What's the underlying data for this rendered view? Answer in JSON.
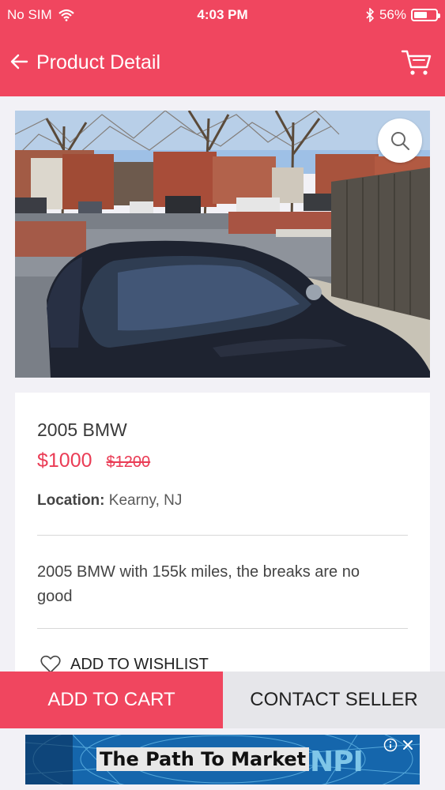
{
  "status_bar": {
    "carrier": "No SIM",
    "time": "4:03 PM",
    "battery": "56%",
    "battery_level": 0.56
  },
  "app_bar": {
    "title": "Product Detail"
  },
  "product": {
    "name": "2005 BMW",
    "price": "$1000",
    "old_price": "$1200",
    "location_label": "Location:",
    "location": "Kearny, NJ",
    "description": "2005 BMW with 155k miles, the breaks are no good",
    "wishlist_label": "ADD TO WISHLIST"
  },
  "actions": {
    "add_to_cart": "ADD TO CART",
    "contact_seller": "CONTACT SELLER"
  },
  "ad": {
    "text": "The Path To Market",
    "logo": "NPI"
  },
  "icons": {
    "back": "arrow-left-icon",
    "cart": "cart-icon",
    "zoom": "search-icon",
    "wifi": "wifi-icon",
    "bluetooth": "bluetooth-icon",
    "wishlist": "heart-outline-icon"
  },
  "colors": {
    "accent": "#f0465f",
    "price": "#ea3c55",
    "secondary_button": "#e6e6ea"
  }
}
